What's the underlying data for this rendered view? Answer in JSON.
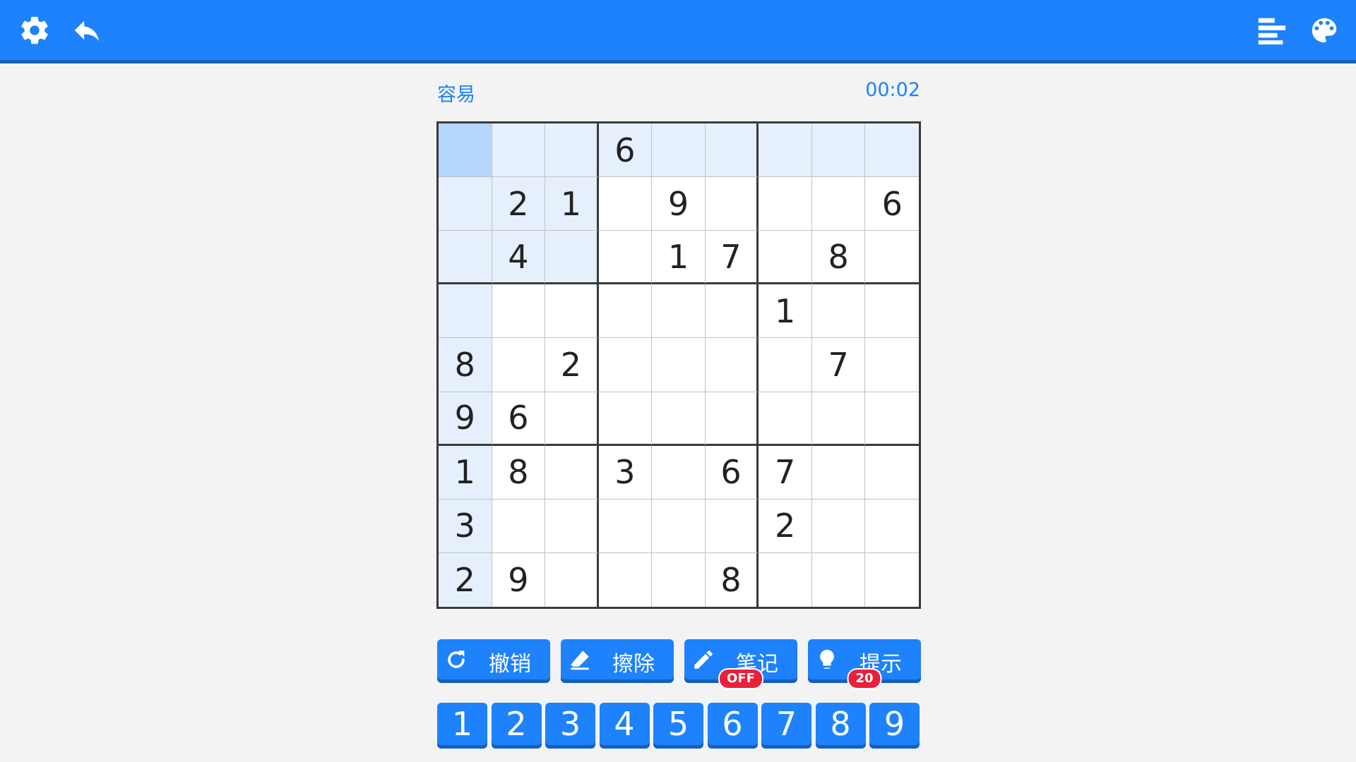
{
  "header": {
    "icons": [
      "gear-icon",
      "back-arrow-icon",
      "menu-icon",
      "palette-icon"
    ],
    "bar_color": "#1d82fb"
  },
  "game": {
    "difficulty": "容易",
    "timer": "00:02",
    "selected_cell": [
      0,
      0
    ],
    "grid": [
      [
        "",
        "",
        "",
        "6",
        "",
        "",
        "",
        "",
        ""
      ],
      [
        "",
        "2",
        "1",
        "",
        "9",
        "",
        "",
        "",
        "6"
      ],
      [
        "",
        "4",
        "",
        "",
        "1",
        "7",
        "",
        "8",
        ""
      ],
      [
        "",
        "",
        "",
        "",
        "",
        "",
        "1",
        "",
        ""
      ],
      [
        "8",
        "",
        "2",
        "",
        "",
        "",
        "",
        "7",
        ""
      ],
      [
        "9",
        "6",
        "",
        "",
        "",
        "",
        "",
        "",
        ""
      ],
      [
        "1",
        "8",
        "",
        "3",
        "",
        "6",
        "7",
        "",
        ""
      ],
      [
        "3",
        "",
        "",
        "",
        "",
        "",
        "2",
        "",
        ""
      ],
      [
        "2",
        "9",
        "",
        "",
        "",
        "8",
        "",
        "",
        ""
      ]
    ]
  },
  "actions": {
    "undo": {
      "label": "撤销",
      "icon": "undo-icon"
    },
    "erase": {
      "label": "擦除",
      "icon": "eraser-icon"
    },
    "notes": {
      "label": "笔记",
      "icon": "pencil-icon",
      "badge": "OFF"
    },
    "hint": {
      "label": "提示",
      "icon": "lightbulb-icon",
      "badge": "20"
    }
  },
  "numpad": [
    "1",
    "2",
    "3",
    "4",
    "5",
    "6",
    "7",
    "8",
    "9"
  ],
  "colors": {
    "accent": "#1d82fb",
    "selected": "#b5d6fc",
    "highlight": "#e6f0fd",
    "badge": "#e8203a"
  }
}
